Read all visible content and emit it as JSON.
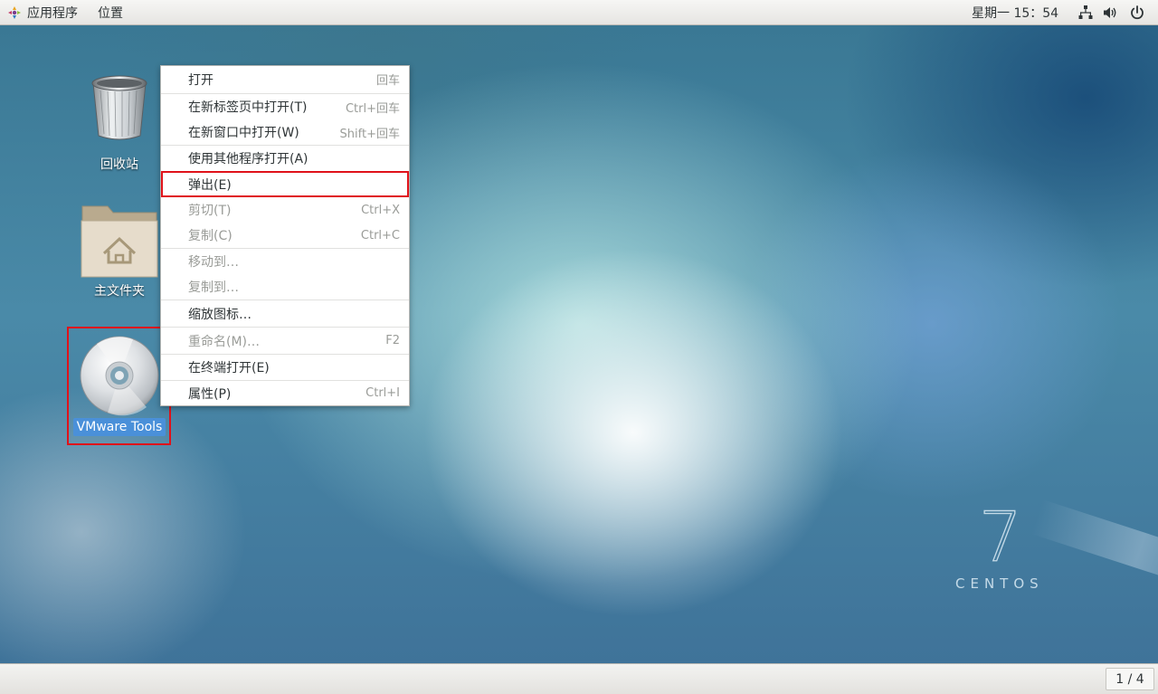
{
  "topbar": {
    "applications_label": "应用程序",
    "places_label": "位置",
    "clock": "星期一 15：54",
    "tray_icons": [
      "network-icon",
      "volume-icon",
      "power-icon"
    ]
  },
  "desktop": {
    "icons": [
      {
        "label": "回收站",
        "icon": "trash-icon"
      },
      {
        "label": "主文件夹",
        "icon": "home-folder-icon"
      },
      {
        "label": "VMware Tools",
        "icon": "cd-disc-icon",
        "selected": true
      }
    ],
    "branding": {
      "version": "7",
      "name": "CENTOS"
    }
  },
  "context_menu": {
    "items": [
      {
        "label": "打开",
        "shortcut": "回车",
        "enabled": true
      },
      {
        "label": "在新标签页中打开(T)",
        "shortcut": "Ctrl+回车",
        "enabled": true
      },
      {
        "label": "在新窗口中打开(W)",
        "shortcut": "Shift+回车",
        "enabled": true
      },
      {
        "label": "使用其他程序打开(A)",
        "shortcut": "",
        "enabled": true
      },
      {
        "label": "弹出(E)",
        "shortcut": "",
        "enabled": true,
        "highlighted": true
      },
      {
        "label": "剪切(T)",
        "shortcut": "Ctrl+X",
        "enabled": false
      },
      {
        "label": "复制(C)",
        "shortcut": "Ctrl+C",
        "enabled": false
      },
      {
        "label": "移动到…",
        "shortcut": "",
        "enabled": false
      },
      {
        "label": "复制到…",
        "shortcut": "",
        "enabled": false
      },
      {
        "label": "缩放图标…",
        "shortcut": "",
        "enabled": true
      },
      {
        "label": "重命名(M)…",
        "shortcut": "F2",
        "enabled": false
      },
      {
        "label": "在终端打开(E)",
        "shortcut": "",
        "enabled": true
      },
      {
        "label": "属性(P)",
        "shortcut": "Ctrl+I",
        "enabled": true
      }
    ]
  },
  "bottombar": {
    "workspace": "1 / 4"
  },
  "colors": {
    "highlight_border": "#e0121a",
    "selection": "#4a90d9"
  }
}
